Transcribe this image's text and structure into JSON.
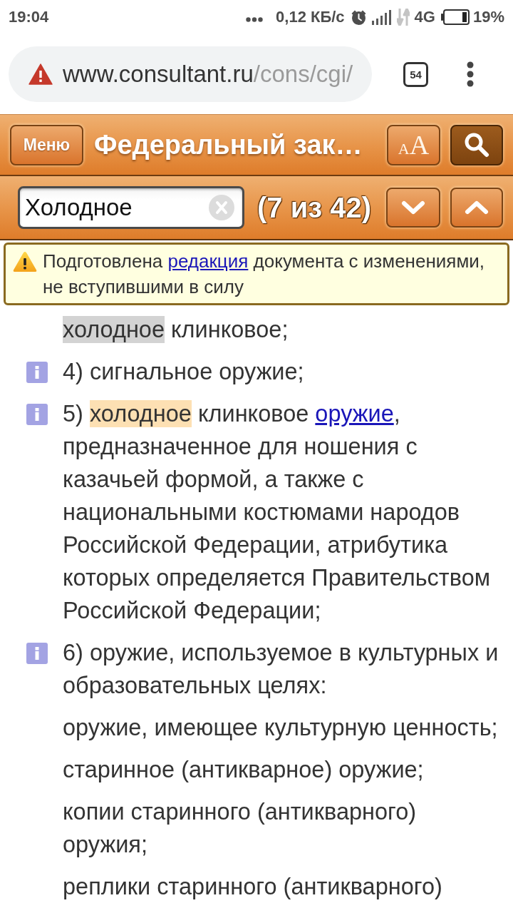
{
  "status_bar": {
    "time": "19:04",
    "network_speed": "0,12 КБ/с",
    "network_type": "4G",
    "battery": "19%"
  },
  "browser": {
    "url_host": "www.consultant.ru",
    "url_path": "/cons/cgi/",
    "tab_count": "54"
  },
  "header": {
    "menu_button": "Меню",
    "title": "Федеральный зак…",
    "text_size_button": {
      "small": "A",
      "large": "A"
    },
    "search_button": {
      "active": true
    }
  },
  "search": {
    "value": "Холодное",
    "counter": "(7 из 42)"
  },
  "notice": {
    "segments": [
      {
        "kind": "text",
        "text": "Подготовлена "
      },
      {
        "kind": "link",
        "text": "редакция"
      },
      {
        "kind": "text",
        "text": " документа с изменениями, не вступившими в силу"
      }
    ]
  },
  "paragraphs": [
    {
      "info": false,
      "segments": [
        {
          "kind": "match",
          "selected": false,
          "text": "холодное"
        },
        {
          "kind": "text",
          "text": " клинковое;"
        }
      ]
    },
    {
      "info": true,
      "segments": [
        {
          "kind": "text",
          "text": "4) сигнальное оружие;"
        }
      ]
    },
    {
      "info": true,
      "segments": [
        {
          "kind": "text",
          "text": "5) "
        },
        {
          "kind": "match",
          "selected": true,
          "text": "холодное"
        },
        {
          "kind": "text",
          "text": " клинковое "
        },
        {
          "kind": "link",
          "text": "оружие"
        },
        {
          "kind": "text",
          "text": ", предназначенное для ношения с казачьей формой, а также с национальными костюмами народов Российской Федерации, атрибутика которых определяется Правительством Российской Федерации;"
        }
      ]
    },
    {
      "info": true,
      "segments": [
        {
          "kind": "text",
          "text": "6) оружие, используемое в культурных и образовательных целях:"
        }
      ]
    },
    {
      "info": false,
      "segments": [
        {
          "kind": "text",
          "text": "оружие, имеющее культурную ценность;"
        }
      ]
    },
    {
      "info": false,
      "segments": [
        {
          "kind": "text",
          "text": "старинное (антикварное) оружие;"
        }
      ]
    },
    {
      "info": false,
      "segments": [
        {
          "kind": "text",
          "text": "копии старинного (антикварного) оружия;"
        }
      ]
    },
    {
      "info": false,
      "segments": [
        {
          "kind": "text",
          "text": "реплики старинного (антикварного)"
        }
      ]
    }
  ]
}
